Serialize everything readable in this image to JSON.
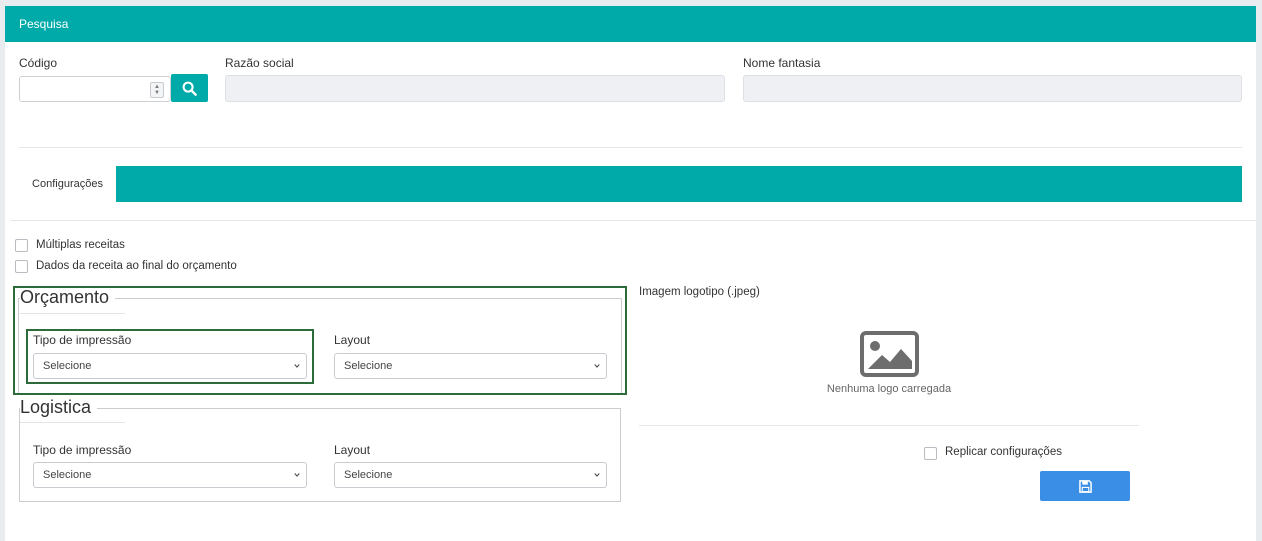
{
  "panel": {
    "title": "Pesquisa"
  },
  "search": {
    "codigo_label": "Código",
    "razao_label": "Razão social",
    "fantasia_label": "Nome fantasia"
  },
  "tabs": [
    {
      "label": "Configurações"
    }
  ],
  "options": {
    "multiplas": "Múltiplas receitas",
    "dados_receita": "Dados da receita ao final do orçamento"
  },
  "orcamento": {
    "legend": "Orçamento",
    "tipo_label": "Tipo de impressão",
    "tipo_value": "Selecione",
    "layout_label": "Layout",
    "layout_value": "Selecione"
  },
  "logistica": {
    "legend": "Logistica",
    "tipo_label": "Tipo de impressão",
    "tipo_value": "Selecione",
    "layout_label": "Layout",
    "layout_value": "Selecione"
  },
  "logo": {
    "label": "Imagem logotipo (.jpeg)",
    "empty_text": "Nenhuma logo carregada"
  },
  "replicar": {
    "label": "Replicar configurações"
  },
  "colors": {
    "accent": "#00aaa8",
    "primary": "#3a8ee6",
    "highlight": "#2e6b3a"
  },
  "icons": [
    "search-icon",
    "image-placeholder-icon",
    "save-icon",
    "chevron-down-icon"
  ]
}
